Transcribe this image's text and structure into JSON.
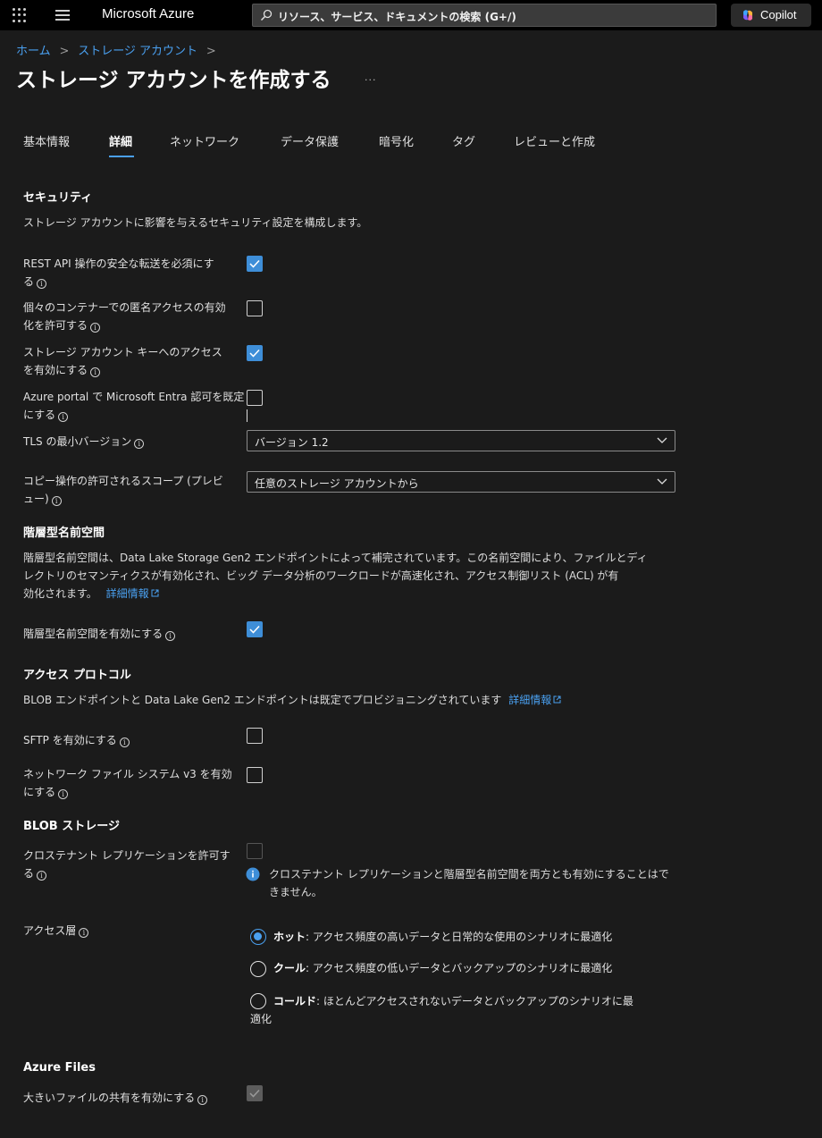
{
  "topbar": {
    "brand": "Microsoft Azure",
    "search_placeholder": "リソース、サービス、ドキュメントの検索 (G+/)",
    "copilot_label": "Copilot"
  },
  "breadcrumb": {
    "home": "ホーム",
    "storage_accounts": "ストレージ アカウント",
    "sep": ">"
  },
  "page_title": "ストレージ アカウントを作成する",
  "more": "...",
  "tabs": [
    "基本情報",
    "詳細",
    "ネットワーク",
    "データ保護",
    "暗号化",
    "タグ",
    "レビューと作成"
  ],
  "security": {
    "title": "セキュリティ",
    "desc": "ストレージ アカウントに影響を与えるセキュリティ設定を構成します。",
    "secure_transfer": {
      "label1": "REST API 操作の安全な転送を必須にす",
      "label2": "る",
      "checked": true
    },
    "anonymous_access": {
      "label1": "個々のコンテナーでの匿名アクセスの有効",
      "label2": "化を許可する",
      "checked": false
    },
    "account_key": {
      "label1": "ストレージ アカウント キーへのアクセス",
      "label2": "を有効にする",
      "checked": true
    },
    "entra_default": {
      "label1": "Azure portal で Microsoft Entra 認可を既定",
      "label2": "にする",
      "checked": false
    },
    "tls": {
      "label": "TLS の最小バージョン",
      "value": "バージョン 1.2"
    },
    "copy_scope": {
      "label1": "コピー操作の許可されるスコープ (プレビ",
      "label2": "ュー)",
      "value": "任意のストレージ アカウントから"
    }
  },
  "hns": {
    "title": "階層型名前空間",
    "desc1": "階層型名前空間は、Data Lake Storage Gen2 エンドポイントによって補完されています。この名前空間により、ファイルとディ",
    "desc2": "レクトリのセマンティクスが有効化され、ビッグ データ分析のワークロードが高速化され、アクセス制御リスト (ACL) が有",
    "desc3": "効化されます。",
    "learn_more": "詳細情報",
    "enable_label": "階層型名前空間を有効にする",
    "enabled": true
  },
  "protocols": {
    "title": "アクセス プロトコル",
    "desc": "BLOB エンドポイントと Data Lake Gen2 エンドポイントは既定でプロビジョニングされています",
    "learn_more": "詳細情報",
    "sftp_label": "SFTP を有効にする",
    "sftp": false,
    "nfs_label1": "ネットワーク ファイル システム v3 を有効",
    "nfs_label2": "にする",
    "nfs": false
  },
  "blob": {
    "title": "BLOB ストレージ",
    "cross_tenant_label1": "クロステナント レプリケーションを許可す",
    "cross_tenant_label2": "る",
    "info1": "クロステナント レプリケーションと階層型名前空間を両方とも有効にすることはで",
    "info2": "きません。",
    "access_tier_label": "アクセス層",
    "tiers": [
      {
        "name": "ホット",
        "desc": ": アクセス頻度の高いデータと日常的な使用のシナリオに最適化",
        "selected": true
      },
      {
        "name": "クール",
        "desc": ": アクセス頻度の低いデータとバックアップのシナリオに最適化",
        "selected": false
      },
      {
        "name": "コールド",
        "desc": ": ほとんどアクセスされないデータとバックアップのシナリオに最",
        "desc2": "適化",
        "selected": false
      }
    ]
  },
  "files": {
    "title": "Azure Files",
    "large_shares_label": "大きいファイルの共有を有効にする",
    "large_shares": true
  },
  "colors": {
    "accent": "#4aa0f0",
    "checkbox": "#3e8ed8",
    "background": "#1b1b1b",
    "topbar": "#000000"
  }
}
